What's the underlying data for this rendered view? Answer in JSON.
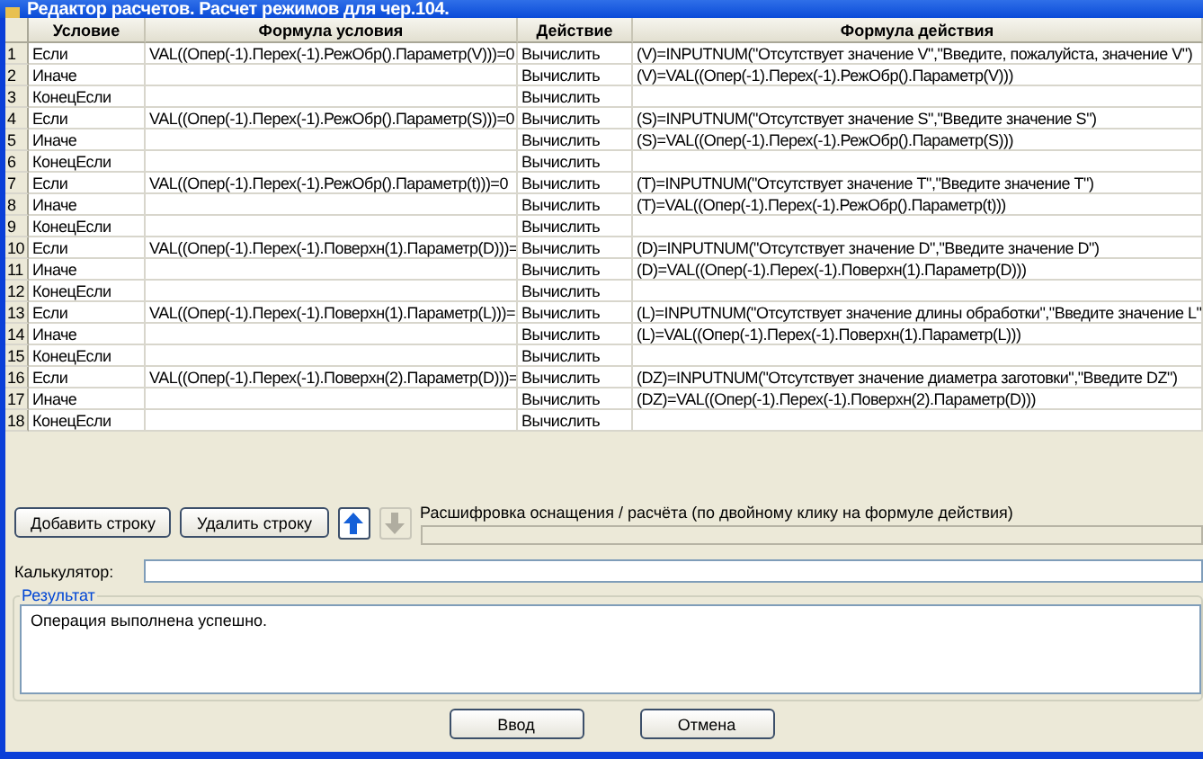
{
  "window": {
    "title": "Редактор расчетов. Расчет режимов для чер.104."
  },
  "table": {
    "columns": [
      "Условие",
      "Формула условия",
      "Действие",
      "Формула действия"
    ],
    "rows": [
      {
        "number": "1",
        "condition": "Если",
        "condition_formula": "VAL((Опер(-1).Перех(-1).РежОбр().Параметр(V)))=0",
        "action": "Вычислить",
        "action_formula": "(V)=INPUTNUM(\"Отсутствует значение V\",\"Введите, пожалуйста, значение V\")"
      },
      {
        "number": "2",
        "condition": "Иначе",
        "action": "Вычислить",
        "action_formula": "(V)=VAL((Опер(-1).Перех(-1).РежОбр().Параметр(V)))"
      },
      {
        "number": "3",
        "condition": "КонецЕсли",
        "action": "Вычислить"
      },
      {
        "number": "4",
        "condition": "Если",
        "condition_formula": "VAL((Опер(-1).Перех(-1).РежОбр().Параметр(S)))=0",
        "action": "Вычислить",
        "action_formula": "(S)=INPUTNUM(\"Отсутствует значение S\",\"Введите значение S\")"
      },
      {
        "number": "5",
        "condition": "Иначе",
        "action": "Вычислить",
        "action_formula": "(S)=VAL((Опер(-1).Перех(-1).РежОбр().Параметр(S)))"
      },
      {
        "number": "6",
        "condition": "КонецЕсли",
        "action": "Вычислить"
      },
      {
        "number": "7",
        "condition": "Если",
        "condition_formula": "VAL((Опер(-1).Перех(-1).РежОбр().Параметр(t)))=0",
        "action": "Вычислить",
        "action_formula": "(T)=INPUTNUM(\"Отсутствует значение T\",\"Введите значение T\")"
      },
      {
        "number": "8",
        "condition": "Иначе",
        "action": "Вычислить",
        "action_formula": "(T)=VAL((Опер(-1).Перех(-1).РежОбр().Параметр(t)))"
      },
      {
        "number": "9",
        "condition": "КонецЕсли",
        "action": "Вычислить"
      },
      {
        "number": "10",
        "condition": "Если",
        "condition_formula": "VAL((Опер(-1).Перех(-1).Поверхн(1).Параметр(D)))=",
        "action": "Вычислить",
        "action_formula": "(D)=INPUTNUM(\"Отсутствует значение D\",\"Введите значение D\")"
      },
      {
        "number": "11",
        "condition": "Иначе",
        "action": "Вычислить",
        "action_formula": "(D)=VAL((Опер(-1).Перех(-1).Поверхн(1).Параметр(D)))"
      },
      {
        "number": "12",
        "condition": "КонецЕсли",
        "action": "Вычислить"
      },
      {
        "number": "13",
        "condition": "Если",
        "condition_formula": "VAL((Опер(-1).Перех(-1).Поверхн(1).Параметр(L)))=",
        "action": "Вычислить",
        "action_formula": "(L)=INPUTNUM(\"Отсутствует значение длины обработки\",\"Введите значение L\""
      },
      {
        "number": "14",
        "condition": "Иначе",
        "action": "Вычислить",
        "action_formula": "(L)=VAL((Опер(-1).Перех(-1).Поверхн(1).Параметр(L)))"
      },
      {
        "number": "15",
        "condition": "КонецЕсли",
        "action": "Вычислить"
      },
      {
        "number": "16",
        "condition": "Если",
        "condition_formula": "VAL((Опер(-1).Перех(-1).Поверхн(2).Параметр(D)))=",
        "action": "Вычислить",
        "action_formula": "(DZ)=INPUTNUM(\"Отсутствует значение диаметра заготовки\",\"Введите DZ\")"
      },
      {
        "number": "17",
        "condition": "Иначе",
        "action": "Вычислить",
        "action_formula": "(DZ)=VAL((Опер(-1).Перех(-1).Поверхн(2).Параметр(D)))"
      },
      {
        "number": "18",
        "condition": "КонецЕсли",
        "action": "Вычислить"
      }
    ]
  },
  "toolbar": [
    {
      "kind": "text",
      "label": "Добавить строку"
    },
    {
      "kind": "text",
      "label": "Удалить строку"
    },
    {
      "kind": "up",
      "disabled": false
    },
    {
      "kind": "down",
      "disabled": true
    }
  ],
  "decoding": {
    "label": "Расшифровка оснащения / расчёта (по двойному клику на формуле действия)"
  },
  "calculator": {
    "label": "Калькулятор:"
  },
  "result": {
    "title": "Результат",
    "text": "Операция выполнена успешно."
  },
  "buttons": [
    "Ввод",
    "Отмена"
  ]
}
